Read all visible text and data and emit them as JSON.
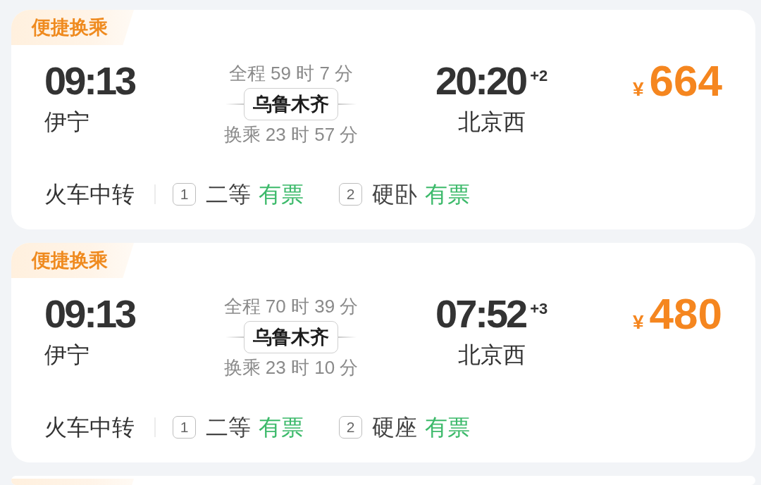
{
  "cards": [
    {
      "kind": "full",
      "tag": "便捷换乘",
      "departure": {
        "time": "09:13",
        "station": "伊宁"
      },
      "transfer": {
        "total_duration": "全程 59 时 7 分",
        "station": "乌鲁木齐",
        "wait": "换乘 23 时 57 分"
      },
      "arrival": {
        "time": "20:20",
        "day_offset": "+2",
        "station": "北京西"
      },
      "price": {
        "currency": "¥",
        "amount": "664"
      },
      "mode": "火车中转",
      "legs": [
        {
          "number": "1",
          "seat_class": "二等",
          "availability": "有票"
        },
        {
          "number": "2",
          "seat_class": "硬卧",
          "availability": "有票"
        }
      ]
    },
    {
      "kind": "full",
      "tag": "便捷换乘",
      "departure": {
        "time": "09:13",
        "station": "伊宁"
      },
      "transfer": {
        "total_duration": "全程 70 时 39 分",
        "station": "乌鲁木齐",
        "wait": "换乘 23 时 10 分"
      },
      "arrival": {
        "time": "07:52",
        "day_offset": "+3",
        "station": "北京西"
      },
      "price": {
        "currency": "¥",
        "amount": "480"
      },
      "mode": "火车中转",
      "legs": [
        {
          "number": "1",
          "seat_class": "二等",
          "availability": "有票"
        },
        {
          "number": "2",
          "seat_class": "硬座",
          "availability": "有票"
        }
      ]
    },
    {
      "kind": "peek"
    }
  ]
}
